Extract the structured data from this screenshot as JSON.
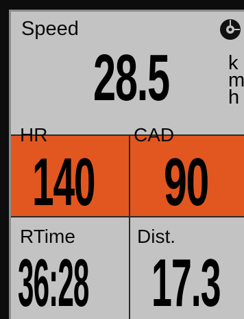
{
  "speed": {
    "label": "Speed",
    "value": "28.5",
    "unit_letters": [
      "k",
      "m",
      "h"
    ]
  },
  "hr": {
    "label": "HR",
    "value": "140"
  },
  "cad": {
    "label": "CAD",
    "value": "90"
  },
  "rtime": {
    "label": "RTime",
    "value": "36:28"
  },
  "dist": {
    "label": "Dist.",
    "value": "17.3"
  },
  "icons": {
    "status": "bicycle-wheel-icon"
  },
  "colors": {
    "screen": "#c3c3c3",
    "highlight": "#e2571f",
    "text": "#000000"
  }
}
